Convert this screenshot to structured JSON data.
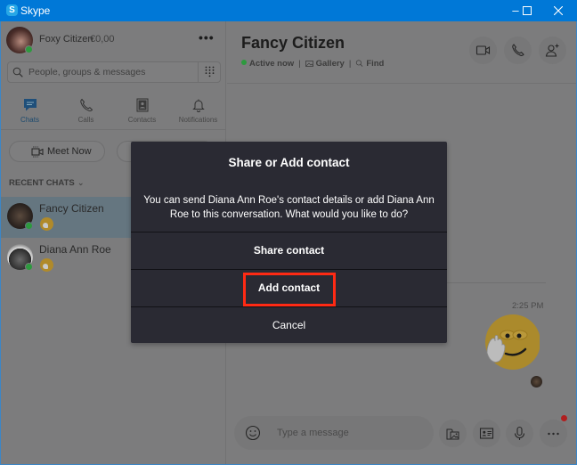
{
  "window": {
    "app_title": "Skype",
    "controls": {
      "minimize": "–",
      "maximize": "☐",
      "close": "✕"
    }
  },
  "profile": {
    "name": "Foxy Citizen",
    "credit": "€0,00",
    "status": "online",
    "more_label": "•••"
  },
  "search": {
    "placeholder": "People, groups & messages"
  },
  "nav_tabs": [
    {
      "label": "Chats",
      "icon": "chat-bubble-icon",
      "active": true
    },
    {
      "label": "Calls",
      "icon": "phone-icon",
      "active": false
    },
    {
      "label": "Contacts",
      "icon": "contacts-book-icon",
      "active": false
    },
    {
      "label": "Notifications",
      "icon": "bell-icon",
      "active": false
    }
  ],
  "actions": {
    "meet_now_label": "Meet Now"
  },
  "recent_chats": {
    "header": "RECENT CHATS",
    "chevron": "⌄",
    "items": [
      {
        "name": "Fancy Citizen",
        "last_message": "facepalm-emoticon",
        "status": "online",
        "selected": true
      },
      {
        "name": "Diana Ann Roe",
        "last_message": "facepalm-emoticon",
        "status": "online",
        "selected": false
      }
    ]
  },
  "conversation": {
    "title": "Fancy Citizen",
    "status": "Active now",
    "gallery_label": "Gallery",
    "find_label": "Find",
    "separator": "|",
    "message_time": "2:25 PM",
    "composer_placeholder": "Type a message"
  },
  "dialog": {
    "title": "Share or Add contact",
    "message": "You can send Diana Ann Roe's contact details or add Diana Ann Roe to this conversation. What would you like to do?",
    "options": {
      "share": "Share contact",
      "add": "Add contact",
      "cancel": "Cancel"
    },
    "highlight_color": "#ff2a14"
  },
  "colors": {
    "titlebar": "#0078d7",
    "dialog_bg": "#2a2a33",
    "presence": "#2d9a3e",
    "notification": "#b01f1f"
  }
}
